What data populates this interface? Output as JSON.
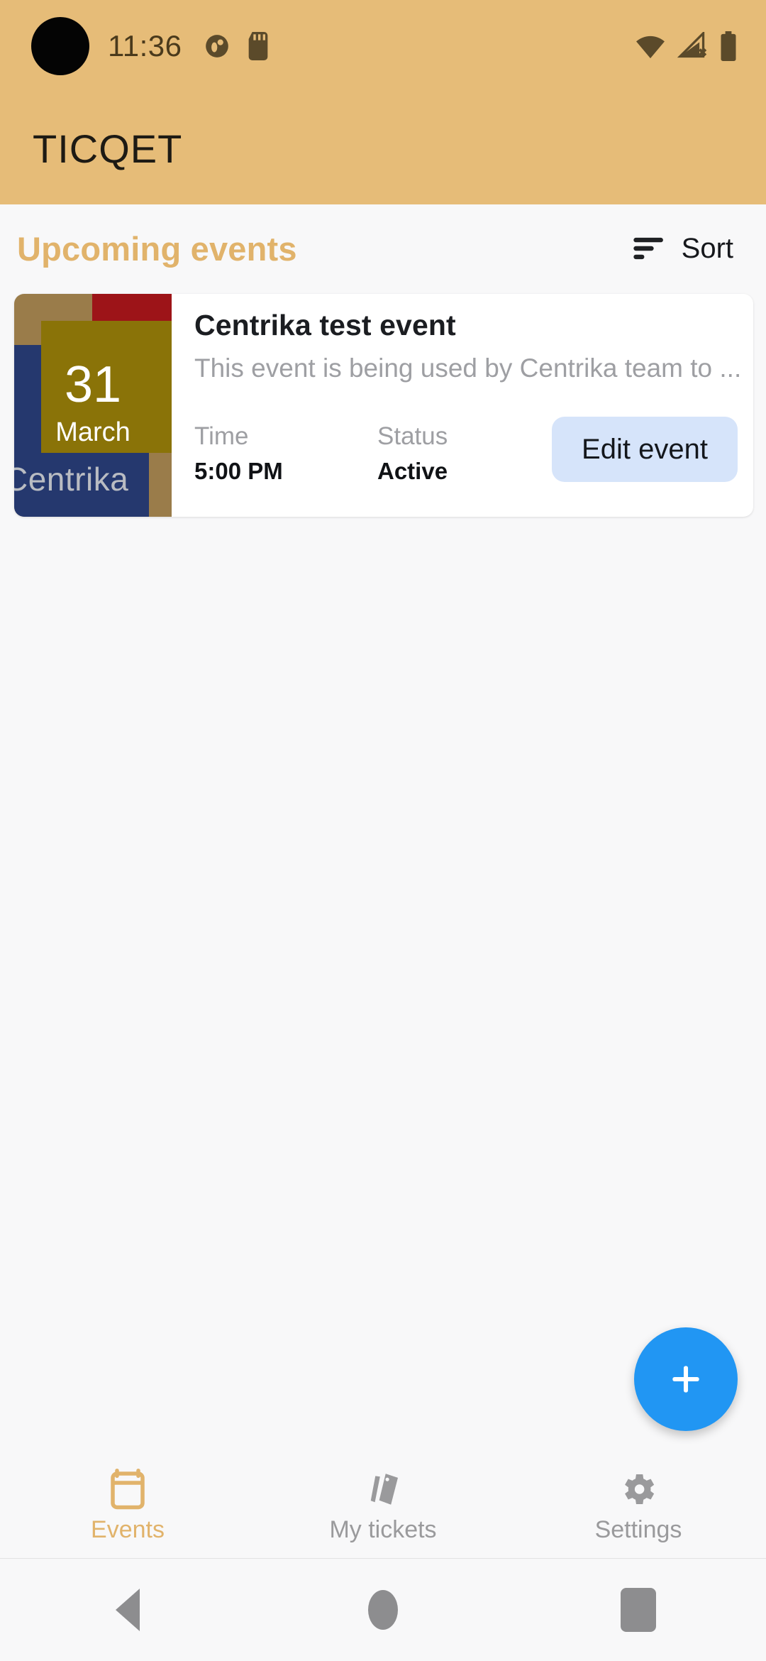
{
  "status_bar": {
    "clock": "11:36",
    "icons": [
      "notification-circle-icon",
      "sd-card-icon",
      "wifi-icon",
      "cellular-no-signal-icon",
      "battery-icon"
    ]
  },
  "app_bar": {
    "title": "TICQET",
    "background": "#e6bc78"
  },
  "section": {
    "title": "Upcoming events",
    "title_color": "#e1b36b",
    "sort_label": "Sort",
    "sort_icon": "sort-lines-icon"
  },
  "event_card": {
    "thumbnail": {
      "day": "31",
      "month": "March",
      "brand": "Centrika",
      "colors": {
        "base": "#9a7c4a",
        "red": "#9d1418",
        "navy": "#25386e",
        "olive": "#8a7308"
      }
    },
    "title": "Centrika test event",
    "description": "This event is being used by Centrika team to ...",
    "meta": [
      {
        "label": "Time",
        "value": "5:00 PM"
      },
      {
        "label": "Status",
        "value": "Active"
      }
    ],
    "edit_button": {
      "label": "Edit event",
      "background": "#d6e4fa"
    }
  },
  "fab": {
    "icon": "plus-icon",
    "color": "#2196f3"
  },
  "bottom_nav": {
    "items": [
      {
        "label": "Events",
        "icon": "calendar-icon",
        "active": true
      },
      {
        "label": "My tickets",
        "icon": "tickets-icon",
        "active": false
      },
      {
        "label": "Settings",
        "icon": "gear-icon",
        "active": false
      }
    ],
    "active_color": "#e1b36b",
    "inactive_color": "#9a9a9c"
  },
  "system_nav": {
    "buttons": [
      "back-button",
      "home-button",
      "recents-button"
    ]
  }
}
